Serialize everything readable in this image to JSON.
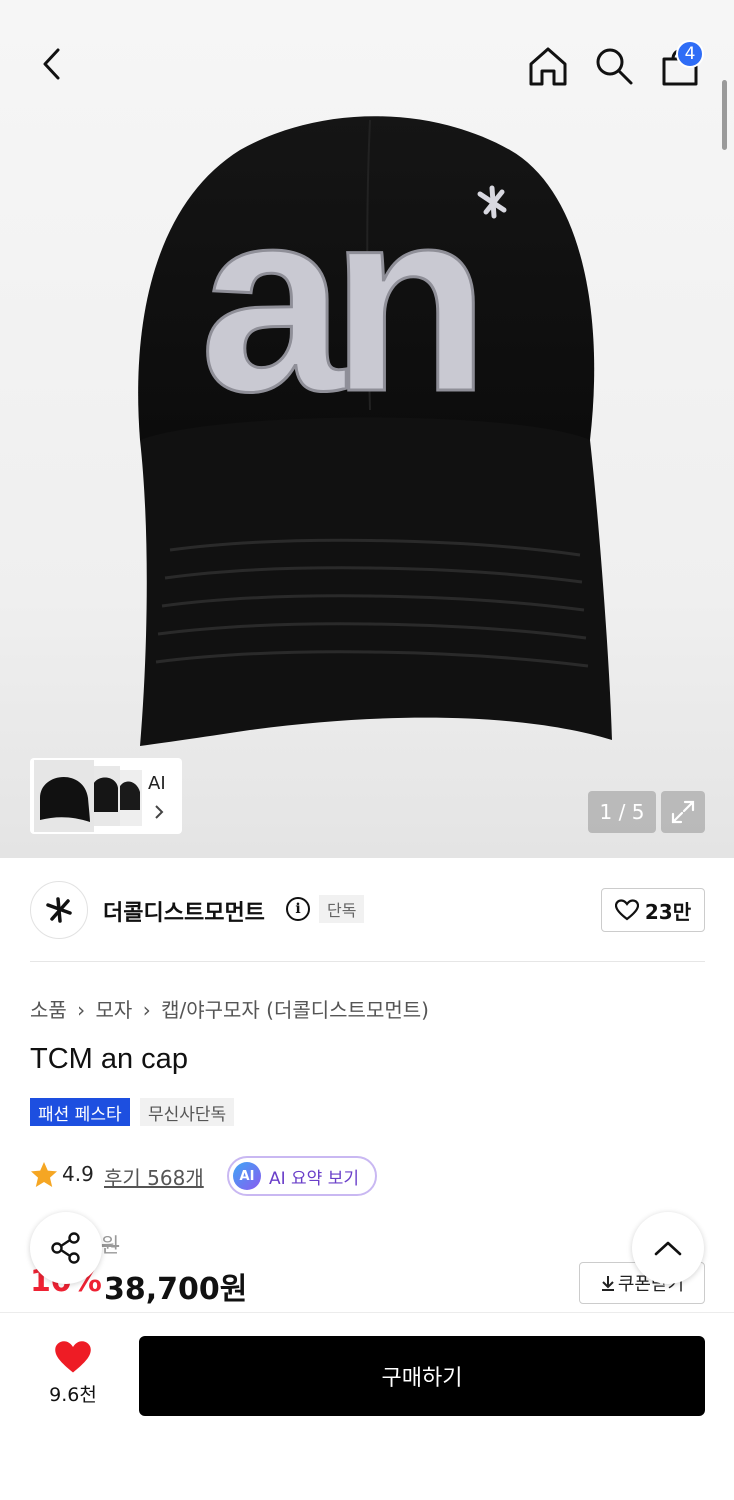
{
  "header": {
    "cart_count": "4"
  },
  "gallery": {
    "thumb_label": "AI",
    "counter": "1 / 5"
  },
  "brand": {
    "name": "더콜디스트모먼트",
    "tag": "단독",
    "likes": "23만"
  },
  "breadcrumb": [
    "소품",
    "모자",
    "캡/야구모자 (더콜디스트모먼트)"
  ],
  "product": {
    "title": "TCM an cap",
    "tags": [
      "패션 페스타",
      "무신사단독"
    ],
    "rating": "4.9",
    "reviews": "후기 568개",
    "ai_summary": "AI 요약 보기",
    "ai_badge": "AI",
    "original_price_partial": "0원",
    "discount": "10%",
    "price": "38,700원",
    "coupon_label": "쿠폰받기"
  },
  "bottom_bar": {
    "wish_count": "9.6천",
    "buy_label": "구매하기"
  },
  "colors": {
    "accent_blue": "#2f6df6",
    "discount_red": "#ee2233",
    "heart_red": "#ee1c25",
    "buy_black": "#000000"
  }
}
